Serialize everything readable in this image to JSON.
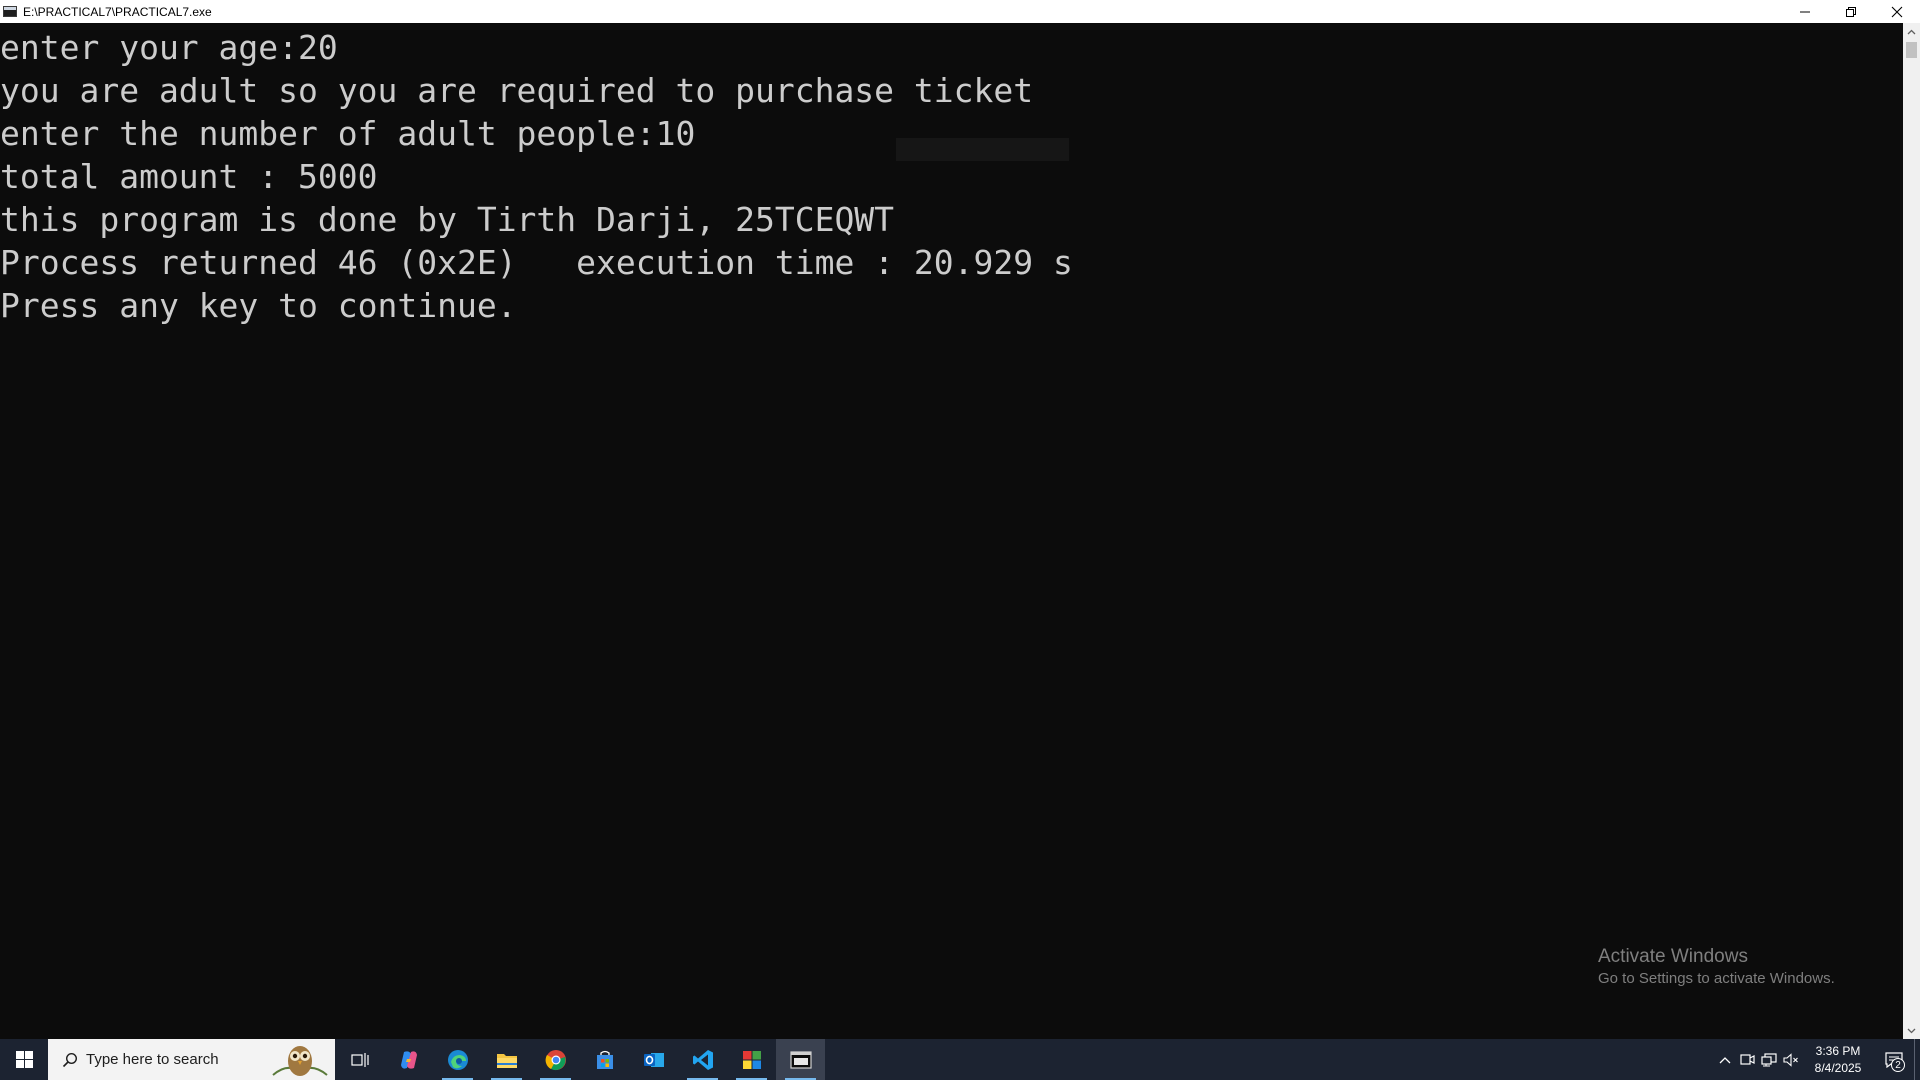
{
  "window": {
    "title": "E:\\PRACTICAL7\\PRACTICAL7.exe",
    "controls": {
      "minimize": "minimize-icon",
      "restore": "restore-icon",
      "close": "close-icon"
    }
  },
  "console": {
    "lines": [
      "enter your age:20",
      "you are adult so you are required to purchase ticket",
      "enter the number of adult people:10",
      "total amount : 5000",
      "this program is done by Tirth Darji, 25TCEQWT",
      "Process returned 46 (0x2E)   execution time : 20.929 s",
      "Press any key to continue."
    ],
    "background": "#0c0c0c",
    "text_color": "#cccccc"
  },
  "watermark": {
    "heading": "Activate Windows",
    "subtext": "Go to Settings to activate Windows."
  },
  "taskbar": {
    "search_placeholder": "Type here to search",
    "apps": [
      "task-view-icon",
      "copilot-icon",
      "edge-icon",
      "file-explorer-icon",
      "chrome-icon",
      "store-icon",
      "outlook-icon",
      "vscode-icon",
      "codeblocks-icon",
      "console-window-icon"
    ],
    "clock_time": "3:36 PM",
    "clock_date": "8/4/2025",
    "notification_count": "2",
    "accent": "#76b9ed",
    "background": "#1c2331"
  }
}
